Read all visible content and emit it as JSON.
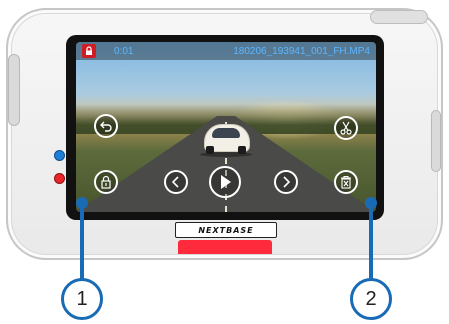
{
  "device": {
    "brand_logo": "NEXTBASE"
  },
  "status_bar": {
    "locked_icon": "lock-icon",
    "playback_time": "0:01",
    "file_name": "180206_193941_001_FH.MP4",
    "text_color": "#5bb7ff",
    "lock_color": "#d01c23"
  },
  "controls": {
    "back_icon": "back-arrow-icon",
    "cut_icon": "scissors-icon",
    "protect_icon": "protect-lock-icon",
    "previous_icon": "chevron-left-icon",
    "play_icon": "play-icon",
    "next_icon": "chevron-right-icon",
    "delete_icon": "trash-icon"
  },
  "callouts": [
    {
      "label": "1"
    },
    {
      "label": "2"
    }
  ],
  "colors": {
    "callout": "#1a6bb5",
    "record_button": "#ff2a3c",
    "led_blue": "#1f7fd6",
    "led_red": "#e8262b"
  }
}
